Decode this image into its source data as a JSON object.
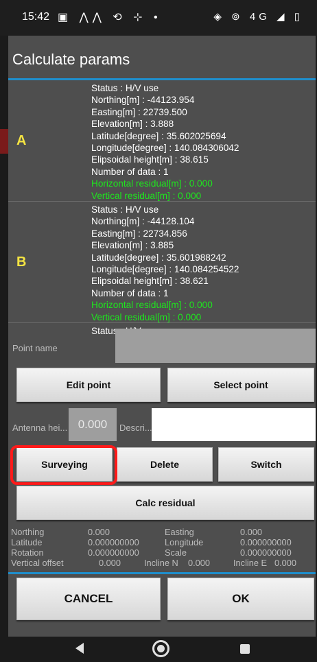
{
  "status_bar": {
    "time": "15:42",
    "left_icons": "▣ ⋀⋀ ⟲ ⊹ •",
    "right_icons": "◈ ⊚ 4G ◢ ▯"
  },
  "dialog": {
    "title": "Calculate params"
  },
  "points": [
    {
      "letter": "A",
      "status": "Status : H/V use",
      "northing": "Northing[m] : -44123.954",
      "easting": "Easting[m] : 22739.500",
      "elevation": "Elevation[m] : 3.888",
      "latitude": "Latitude[degree] : 35.602025694",
      "longitude": "Longitude[degree] : 140.084306042",
      "ellipsoidal": "Elipsoidal height[m] : 38.615",
      "count": "Number of data : 1",
      "h_residual": "Horizontal residual[m] : 0.000",
      "v_residual": "Vertical residual[m] : 0.000"
    },
    {
      "letter": "B",
      "status": "Status : H/V use",
      "northing": "Northing[m] : -44128.104",
      "easting": "Easting[m] : 22734.856",
      "elevation": "Elevation[m] : 3.885",
      "latitude": "Latitude[degree] : 35.601988242",
      "longitude": "Longitude[degree] : 140.084254522",
      "ellipsoidal": "Elipsoidal height[m] : 38.621",
      "count": "Number of data : 1",
      "h_residual": "Horizontal residual[m] : 0.000",
      "v_residual": "Vertical residual[m] : 0.000"
    },
    {
      "status": "Status : H/V use"
    }
  ],
  "form": {
    "point_name_label": "Point name",
    "point_name_value": "",
    "antenna_label": "Antenna hei...",
    "antenna_value": "0.000",
    "description_label": "Descri...",
    "description_value": ""
  },
  "buttons": {
    "edit_point": "Edit point",
    "select_point": "Select point",
    "surveying": "Surveying",
    "delete": "Delete",
    "switch": "Switch",
    "calc_residual": "Calc residual",
    "cancel": "CANCEL",
    "ok": "OK"
  },
  "results": {
    "northing_label": "Northing",
    "northing_value": "0.000",
    "easting_label": "Easting",
    "easting_value": "0.000",
    "latitude_label": "Latitude",
    "latitude_value": "0.000000000",
    "longitude_label": "Longitude",
    "longitude_value": "0.000000000",
    "rotation_label": "Rotation",
    "rotation_value": "0.000000000",
    "scale_label": "Scale",
    "scale_value": "0.000000000",
    "vertical_offset_label": "Vertical offset",
    "vertical_offset_value": "0.000",
    "incline_n_label": "Incline N",
    "incline_n_value": "0.000",
    "incline_e_label": "Incline E",
    "incline_e_value": "0.000"
  },
  "colors": {
    "accent": "#1f8ecb",
    "point_letter": "#f5e442",
    "residual_text": "#1ee61e",
    "highlight": "#ff1a1a"
  },
  "nav_icons": [
    "back-icon",
    "home-icon",
    "recents-icon"
  ]
}
